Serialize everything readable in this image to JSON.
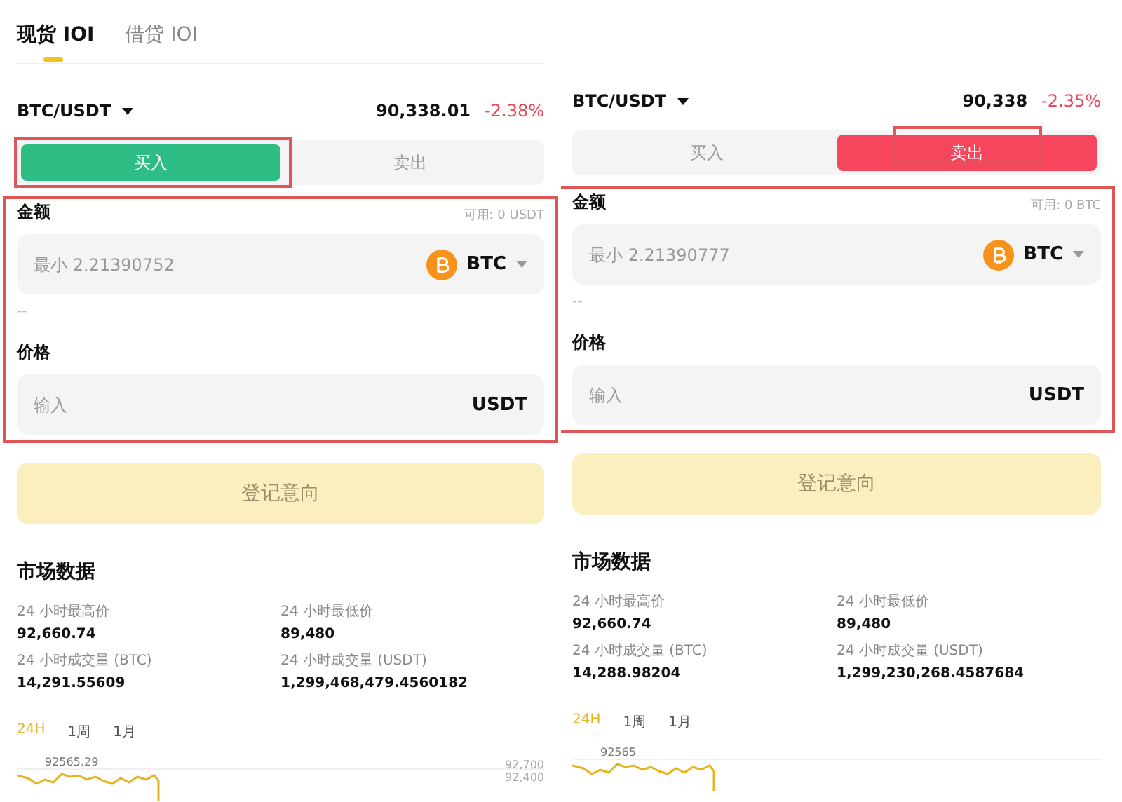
{
  "panels": [
    {
      "tabs": [
        {
          "label": "现货 IOI",
          "selected": true
        },
        {
          "label": "借贷 IOI",
          "selected": false
        }
      ],
      "pair": "BTC/USDT",
      "price": "90,338.01",
      "change": "-2.38%",
      "sides": [
        {
          "label": "买入",
          "kind": "buy",
          "selected": true,
          "annotated": true
        },
        {
          "label": "卖出",
          "kind": "sell",
          "selected": false,
          "annotated": false
        }
      ],
      "form_annotated": true,
      "amount": {
        "label": "金额",
        "available": "可用: 0 USDT",
        "placeholder": "最小 2.21390752",
        "currency": "BTC"
      },
      "estimate": "--",
      "price_field": {
        "label": "价格",
        "placeholder": "输入",
        "currency": "USDT"
      },
      "submit": {
        "label": "登记意向",
        "disabled": true
      },
      "market": {
        "title": "市场数据",
        "stats": [
          {
            "label": "24 小时最高价",
            "value": "92,660.74"
          },
          {
            "label": "24 小时最低价",
            "value": "89,480"
          },
          {
            "label": "24 小时成交量 (BTC)",
            "value": "14,291.55609"
          },
          {
            "label": "24 小时成交量 (USDT)",
            "value": "1,299,468,479.4560182"
          }
        ]
      },
      "periods": [
        {
          "label": "24H",
          "selected": true
        },
        {
          "label": "1周",
          "selected": false
        },
        {
          "label": "1月",
          "selected": false
        }
      ],
      "chart": {
        "peak_label": "92565.29",
        "axis_labels": [
          "92,700",
          "92,400"
        ]
      }
    },
    {
      "pair": "BTC/USDT",
      "price": "90,338",
      "change": "-2.35%",
      "sides": [
        {
          "label": "买入",
          "kind": "buy",
          "selected": false,
          "annotated": false
        },
        {
          "label": "卖出",
          "kind": "sell",
          "selected": true,
          "annotated": true
        }
      ],
      "form_annotated": true,
      "amount": {
        "label": "金额",
        "available": "可用: 0 BTC",
        "placeholder": "最小 2.21390777",
        "currency": "BTC"
      },
      "estimate": "--",
      "price_field": {
        "label": "价格",
        "placeholder": "输入",
        "currency": "USDT"
      },
      "submit": {
        "label": "登记意向",
        "disabled": true
      },
      "market": {
        "title": "市场数据",
        "stats": [
          {
            "label": "24 小时最高价",
            "value": "92,660.74"
          },
          {
            "label": "24 小时最低价",
            "value": "89,480"
          },
          {
            "label": "24 小时成交量 (BTC)",
            "value": "14,288.98204"
          },
          {
            "label": "24 小时成交量 (USDT)",
            "value": "1,299,230,268.4587684"
          }
        ]
      },
      "periods": [
        {
          "label": "24H",
          "selected": true
        },
        {
          "label": "1周",
          "selected": false
        },
        {
          "label": "1月",
          "selected": false
        }
      ],
      "chart": {
        "peak_label": "92565"
      }
    }
  ]
}
